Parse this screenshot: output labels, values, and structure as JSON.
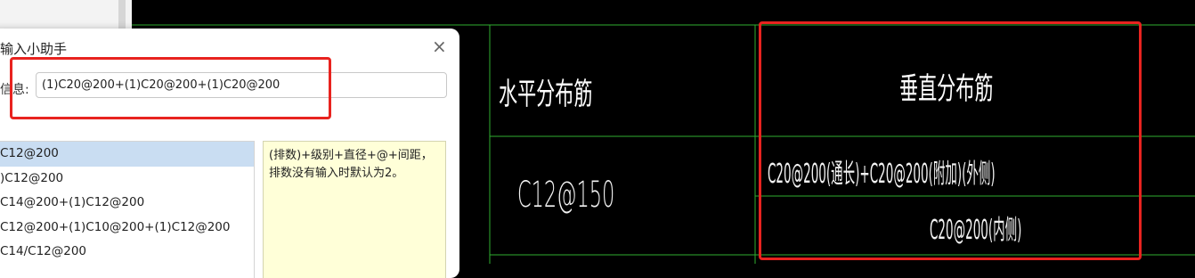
{
  "dialog": {
    "title": "输入小助手",
    "close_glyph": "×",
    "info_label": "信息:",
    "info_value": "(1)C20@200+(1)C20@200+(1)C20@200",
    "list_items": [
      "C12@200",
      ")C12@200",
      "C14@200+(1)C12@200",
      "C12@200+(1)C10@200+(1)C12@200",
      "C14/C12@200"
    ],
    "selected_index": 0,
    "hint_text": "(排数)+级别+直径+@+间距，排数没有输入时默认为2。"
  },
  "cad": {
    "header_horizontal": "水平分布筋",
    "header_vertical": "垂直分布筋",
    "value_horizontal": "C12@150",
    "value_vertical_line1": "C20@200(通长)+C20@200(附加)(外侧)",
    "value_vertical_line2": "C20@200(内侧)"
  },
  "colors": {
    "highlight_box": "#e8231f",
    "grid_line": "#2fae2f",
    "cad_background": "#000000",
    "selected_row": "#c9ddf2",
    "hint_background": "#ffffd8"
  }
}
